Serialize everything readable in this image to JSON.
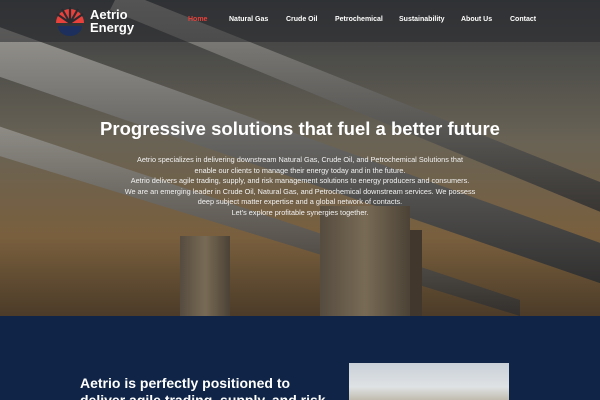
{
  "brand": {
    "line1": "Aetrio",
    "line2": "Energy",
    "colors": {
      "red": "#e8403a",
      "navy": "#1d2f5c"
    }
  },
  "nav": {
    "items": [
      {
        "label": "Home",
        "active": true
      },
      {
        "label": "Natural Gas"
      },
      {
        "label": "Crude Oil"
      },
      {
        "label": "Petrochemical"
      },
      {
        "label": "Sustainability"
      },
      {
        "label": "About Us"
      },
      {
        "label": "Contact"
      }
    ]
  },
  "hero": {
    "title": "Progressive solutions that fuel a better future",
    "lines": [
      "Aetrio specializes in delivering downstream Natural Gas, Crude Oil, and Petrochemical Solutions that",
      "enable our clients to manage their energy today and in the future.",
      "Aetrio delivers agile trading, supply, and risk management solutions to energy producers and consumers.",
      "We are an emerging leader in Crude Oil, Natural Gas, and Petrochemical downstream services. We possess",
      "deep subject matter expertise and a global network of contacts.",
      "Let's explore profitable synergies together."
    ]
  },
  "about": {
    "heading_line1": "Aetrio is perfectly positioned to",
    "heading_line2": "deliver agile trading, supply, and risk"
  },
  "colors": {
    "section_bg": "#0f2446",
    "active_nav": "#e8403a"
  }
}
